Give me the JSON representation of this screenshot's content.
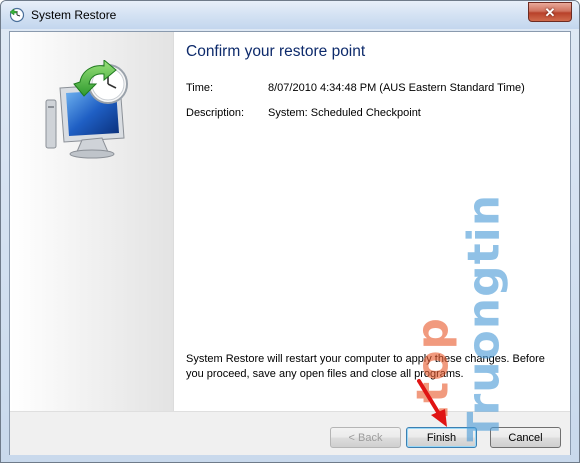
{
  "window": {
    "title": "System Restore",
    "close_label": "✕"
  },
  "content": {
    "heading": "Confirm your restore point",
    "time_label": "Time:",
    "time_value": "8/07/2010 4:34:48 PM (AUS Eastern Standard Time)",
    "description_label": "Description:",
    "description_value": "System: Scheduled Checkpoint",
    "notice": "System Restore will restart your computer to apply these changes. Before you proceed, save any open files and close all programs."
  },
  "buttons": {
    "back": "< Back",
    "finish": "Finish",
    "cancel": "Cancel"
  },
  "icons": {
    "app": "system-restore-icon",
    "illustration": "monitor-clock-restore-icon",
    "annotation": "red-arrow-icon"
  },
  "watermark": {
    "text_blue": "Truongtin",
    "text_orange": ".top",
    "color_blue": "#4a9ad6",
    "color_orange": "#e85a2e"
  }
}
